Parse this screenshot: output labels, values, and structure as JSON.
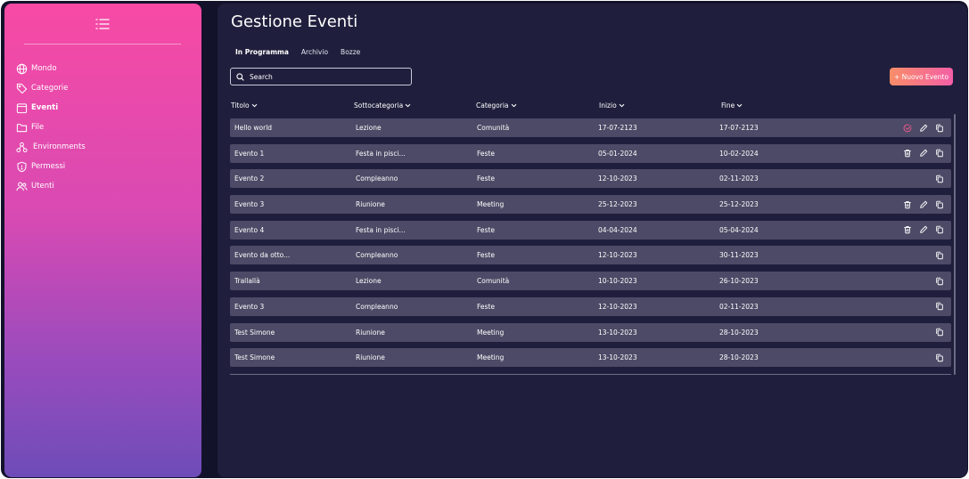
{
  "app": {
    "title": "Gestione Eventi"
  },
  "colors": {
    "accent": "#f45fa6",
    "check": "#f05a8a"
  },
  "sidebar": {
    "toggle_icon": "list-icon",
    "items": [
      {
        "label": "Mondo",
        "icon": "globe-icon",
        "active": false
      },
      {
        "label": "Categorie",
        "icon": "tag-icon",
        "active": false
      },
      {
        "label": "Eventi",
        "icon": "calendar-icon",
        "active": true
      },
      {
        "label": "File",
        "icon": "folder-icon",
        "active": false
      },
      {
        "label": "Environments",
        "icon": "network-icon",
        "active": false
      },
      {
        "label": "Permessi",
        "icon": "shield-icon",
        "active": false
      },
      {
        "label": "Utenti",
        "icon": "users-icon",
        "active": false
      }
    ]
  },
  "tabs": [
    {
      "label": "In Programma",
      "active": true
    },
    {
      "label": "Archivio",
      "active": false
    },
    {
      "label": "Bozze",
      "active": false
    }
  ],
  "search": {
    "placeholder": "Search",
    "value": ""
  },
  "toolbar": {
    "new_event_label": "+ Nuovo Evento"
  },
  "table": {
    "columns": [
      "Titolo",
      "Sottocategoria",
      "Categoria",
      "Inizio",
      "Fine"
    ],
    "rows": [
      {
        "title": "Hello world",
        "sub": "Lezione",
        "cat": "Comunità",
        "start": "17-07-2123",
        "end": "17-07-2123",
        "actions": [
          "check-circle-icon",
          "pencil-icon",
          "copy-icon"
        ]
      },
      {
        "title": "Evento 1",
        "sub": "Festa in pisci...",
        "cat": "Feste",
        "start": "05-01-2024",
        "end": "10-02-2024",
        "actions": [
          "trash-icon",
          "pencil-icon",
          "copy-icon"
        ]
      },
      {
        "title": "Evento 2",
        "sub": "Compleanno",
        "cat": "Feste",
        "start": "12-10-2023",
        "end": "02-11-2023",
        "actions": [
          "copy-icon"
        ]
      },
      {
        "title": "Evento 3",
        "sub": "Riunione",
        "cat": "Meeting",
        "start": "25-12-2023",
        "end": "25-12-2023",
        "actions": [
          "trash-icon",
          "pencil-icon",
          "copy-icon"
        ]
      },
      {
        "title": "Evento 4",
        "sub": "Festa in pisci...",
        "cat": "Feste",
        "start": "04-04-2024",
        "end": "05-04-2024",
        "actions": [
          "trash-icon",
          "pencil-icon",
          "copy-icon"
        ]
      },
      {
        "title": "Evento da otto...",
        "sub": "Compleanno",
        "cat": "Feste",
        "start": "12-10-2023",
        "end": "30-11-2023",
        "actions": [
          "copy-icon"
        ]
      },
      {
        "title": "Trallallà",
        "sub": "Lezione",
        "cat": "Comunità",
        "start": "10-10-2023",
        "end": "26-10-2023",
        "actions": [
          "copy-icon"
        ]
      },
      {
        "title": "Evento 3",
        "sub": "Compleanno",
        "cat": "Feste",
        "start": "12-10-2023",
        "end": "02-11-2023",
        "actions": [
          "copy-icon"
        ]
      },
      {
        "title": "Test Simone",
        "sub": "Riunione",
        "cat": "Meeting",
        "start": "13-10-2023",
        "end": "28-10-2023",
        "actions": [
          "copy-icon"
        ]
      },
      {
        "title": "Test Simone",
        "sub": "Riunione",
        "cat": "Meeting",
        "start": "13-10-2023",
        "end": "28-10-2023",
        "actions": [
          "copy-icon"
        ]
      }
    ]
  }
}
